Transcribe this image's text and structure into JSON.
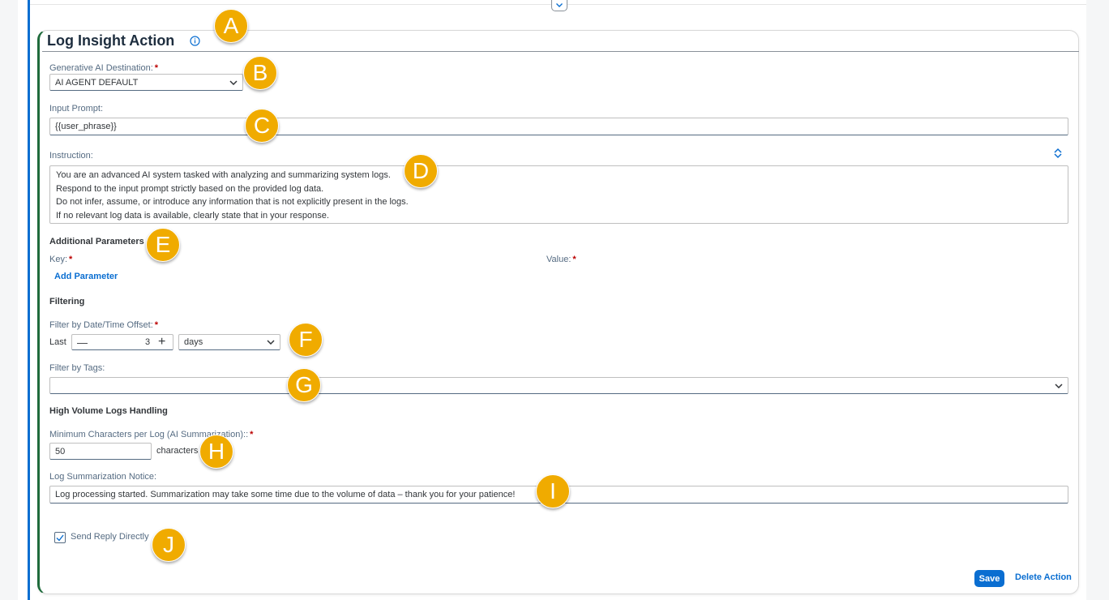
{
  "header": {
    "title": "Log Insight Action",
    "info_icon": "info-icon"
  },
  "gen_ai_destination": {
    "label": "Generative AI Destination:",
    "required": "*",
    "value": "AI AGENT DEFAULT"
  },
  "input_prompt": {
    "label": "Input Prompt:",
    "value": "{{user_phrase}}"
  },
  "instruction": {
    "label": "Instruction:",
    "lines": [
      "You are an advanced AI system tasked with analyzing and summarizing system logs.",
      "Respond to the input prompt strictly based on the provided log data.",
      "Do not infer, assume, or introduce any information that is not explicitly present in the logs.",
      "If no relevant log data is available, clearly state that in your response."
    ]
  },
  "additional_parameters": {
    "heading": "Additional Parameters",
    "key_label": "Key:",
    "value_label": "Value:",
    "required": "*",
    "add_link": "Add Parameter"
  },
  "filtering": {
    "heading": "Filtering",
    "offset_label": "Filter by Date/Time Offset:",
    "required": "*",
    "last_label": "Last",
    "minus": "—",
    "stepper_value": "3",
    "plus": "+",
    "unit_value": "days",
    "tags_label": "Filter by Tags:",
    "tags_value": ""
  },
  "high_volume": {
    "heading": "High Volume Logs Handling",
    "min_chars_label": "Minimum Characters per Log (AI Summarization)::",
    "required": "*",
    "min_chars_value": "50",
    "unit": "characters",
    "notice_label": "Log Summarization Notice:",
    "notice_value": "Log processing started. Summarization may take some time due to the volume of data – thank you for your patience!"
  },
  "send_reply": {
    "label": "Send Reply Directly",
    "checked": true
  },
  "footer": {
    "save": "Save",
    "delete": "Delete Action"
  },
  "callouts": [
    "A",
    "B",
    "C",
    "D",
    "E",
    "F",
    "G",
    "H",
    "I",
    "J"
  ],
  "colors": {
    "accent": "#0a6ed1",
    "card_border": "#1f6b3c",
    "callout": "#f0ab00",
    "required": "#bb0000"
  }
}
